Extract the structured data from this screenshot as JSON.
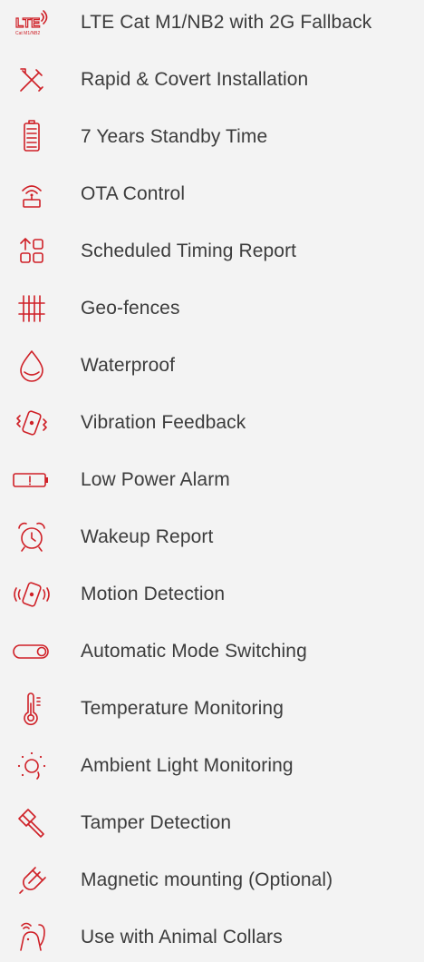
{
  "accent_color": "#cf2027",
  "text_color": "#3c3c3c",
  "features": [
    {
      "icon": "lte-icon",
      "icon_caption": "Cat M1/NB2",
      "label": "LTE Cat M1/NB2 with 2G Fallback"
    },
    {
      "icon": "tools-icon",
      "label": "Rapid & Covert Installation"
    },
    {
      "icon": "battery-icon",
      "label": "7 Years Standby Time"
    },
    {
      "icon": "ota-icon",
      "label": "OTA Control"
    },
    {
      "icon": "schedule-icon",
      "label": "Scheduled Timing Report"
    },
    {
      "icon": "fence-icon",
      "label": "Geo-fences"
    },
    {
      "icon": "water-drop-icon",
      "label": "Waterproof"
    },
    {
      "icon": "vibration-icon",
      "label": "Vibration Feedback"
    },
    {
      "icon": "low-battery-icon",
      "label": "Low Power Alarm"
    },
    {
      "icon": "alarm-clock-icon",
      "label": "Wakeup Report"
    },
    {
      "icon": "motion-icon",
      "label": "Motion Detection"
    },
    {
      "icon": "toggle-icon",
      "label": "Automatic Mode Switching"
    },
    {
      "icon": "thermometer-icon",
      "label": "Temperature Monitoring"
    },
    {
      "icon": "light-icon",
      "label": "Ambient Light Monitoring"
    },
    {
      "icon": "hammer-icon",
      "label": "Tamper Detection"
    },
    {
      "icon": "magnet-icon",
      "label": "Magnetic mounting (Optional)"
    },
    {
      "icon": "animal-collar-icon",
      "label": "Use with Animal Collars"
    }
  ]
}
